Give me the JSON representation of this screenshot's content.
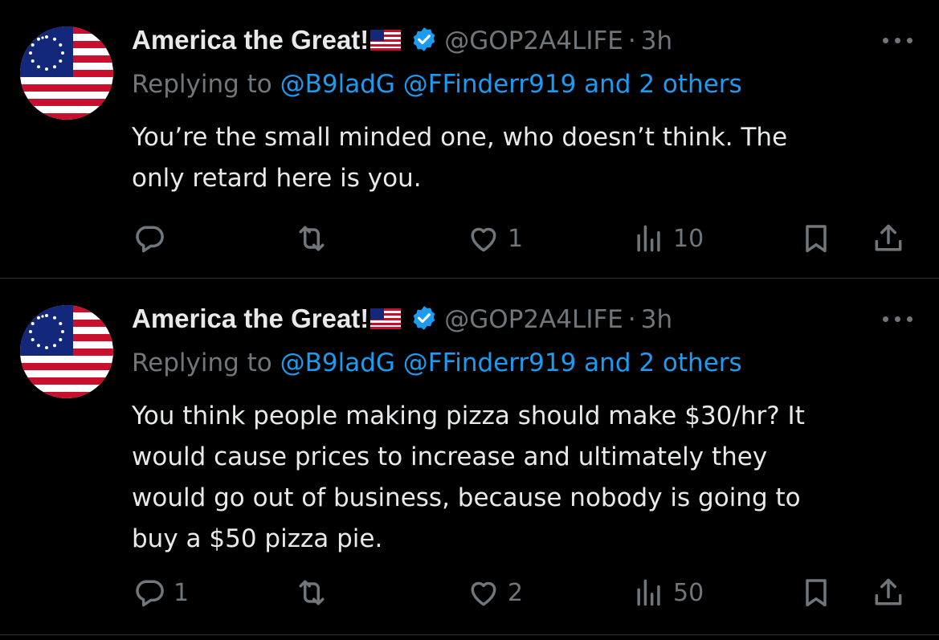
{
  "tweets": [
    {
      "display_name": "America the Great!",
      "handle": "@GOP2A4LIFE",
      "separator": "·",
      "time": "3h",
      "replying_prefix": "Replying to",
      "mentions": "@B9ladG @FFinderr919 and 2 others",
      "text": "You’re the small minded one, who doesn’t think. The\nonly retard here is you.",
      "replies": "",
      "reposts": "",
      "likes": "1",
      "views": "10"
    },
    {
      "display_name": "America the Great!",
      "handle": "@GOP2A4LIFE",
      "separator": "·",
      "time": "3h",
      "replying_prefix": "Replying to",
      "mentions": "@B9ladG @FFinderr919 and 2 others",
      "text": "You think people making pizza should make $30/hr? It\nwould cause prices to increase and ultimately they\nwould go out of business, because nobody is going to\nbuy a $50 pizza pie.",
      "replies": "1",
      "reposts": "",
      "likes": "2",
      "views": "50"
    }
  ],
  "icons": {
    "avatar": "american-flag-avatar-icon",
    "flag_emoji": "us-flag-emoji-icon",
    "verified": "verified-badge-icon",
    "more": "more-options-icon",
    "reply": "reply-icon",
    "repost": "repost-icon",
    "like": "heart-icon",
    "views": "views-chart-icon",
    "bookmark": "bookmark-icon",
    "share": "share-icon"
  },
  "colors": {
    "background": "#000000",
    "text": "#e7e9ea",
    "muted": "#71767b",
    "link": "#1d9bf0",
    "divider": "#2f3336"
  }
}
